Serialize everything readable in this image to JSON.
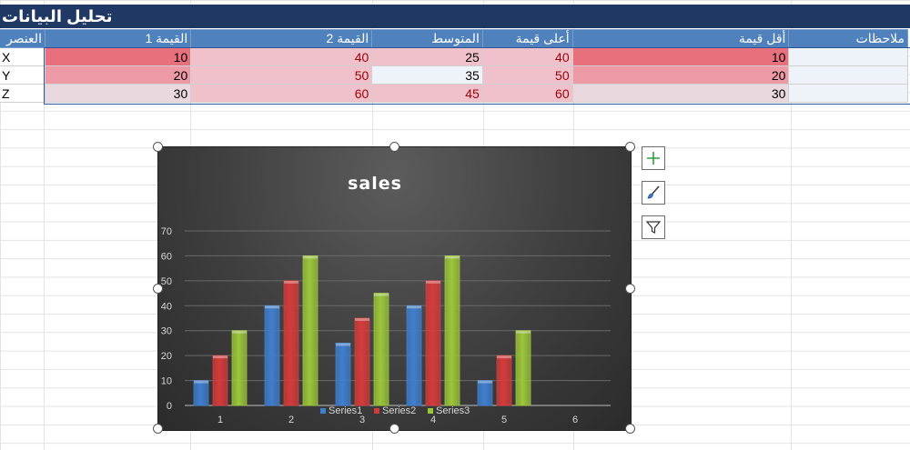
{
  "sheet": {
    "title": "تحليل البيانات",
    "headers": [
      "العنصر",
      "القيمة 1",
      "القيمة 2",
      "المتوسط",
      "أعلى قيمة",
      "أقل قيمة",
      "ملاحظات"
    ],
    "rows": [
      {
        "item": "X",
        "v1": "10",
        "v2": "40",
        "avg": "25",
        "max": "40",
        "min": "10",
        "notes": ""
      },
      {
        "item": "Y",
        "v1": "20",
        "v2": "50",
        "avg": "35",
        "max": "50",
        "min": "20",
        "notes": ""
      },
      {
        "item": "Z",
        "v1": "30",
        "v2": "60",
        "avg": "45",
        "max": "60",
        "min": "30",
        "notes": ""
      }
    ],
    "colors": {
      "header_bg": "#4f81bd",
      "title_bg": "#1f3864",
      "text_red": "#9c0006"
    }
  },
  "chart_tools": {
    "add_element": "chart-elements-button",
    "style": "chart-styles-button",
    "filter": "chart-filters-button"
  },
  "chart_data": {
    "type": "bar",
    "title": "sales",
    "categories": [
      "1",
      "2",
      "3",
      "4",
      "5",
      "6"
    ],
    "series": [
      {
        "name": "Series1",
        "color": "#3f7fd0",
        "values": [
          10,
          40,
          25,
          40,
          10,
          null
        ]
      },
      {
        "name": "Series2",
        "color": "#d63b3b",
        "values": [
          20,
          50,
          35,
          50,
          20,
          null
        ]
      },
      {
        "name": "Series3",
        "color": "#9cc63a",
        "values": [
          30,
          60,
          45,
          60,
          30,
          null
        ]
      }
    ],
    "ylim": [
      0,
      70
    ],
    "yticks": [
      0,
      10,
      20,
      30,
      40,
      50,
      60,
      70
    ],
    "grid": true,
    "legend": "bottom"
  }
}
